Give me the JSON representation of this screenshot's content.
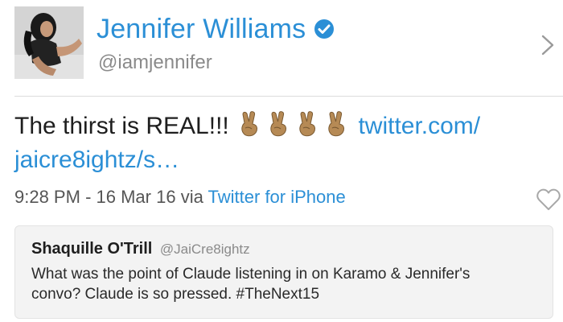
{
  "profile": {
    "display_name": "Jennifer Williams",
    "handle": "@iamjennifer",
    "verified": true
  },
  "tweet": {
    "text": "The thirst is REAL!!!",
    "emoji": [
      "victory-hand",
      "victory-hand",
      "victory-hand",
      "victory-hand"
    ],
    "link_line1": "twitter.com/",
    "link_line2": "jaicre8ightz/s…",
    "time": "9:28 PM",
    "separator": "-",
    "date": "16 Mar 16",
    "via_label": "via",
    "source": "Twitter for iPhone"
  },
  "quoted_tweet": {
    "name": "Shaquille O'Trill",
    "handle": "@JaiCre8ightz",
    "text": "What was the point of Claude listening in on Karamo & Jennifer's convo? Claude is so pressed. #TheNext15"
  },
  "colors": {
    "accent": "#2b8fd6",
    "muted": "#8a8a8a",
    "quote_background": "#f3f3f3"
  }
}
